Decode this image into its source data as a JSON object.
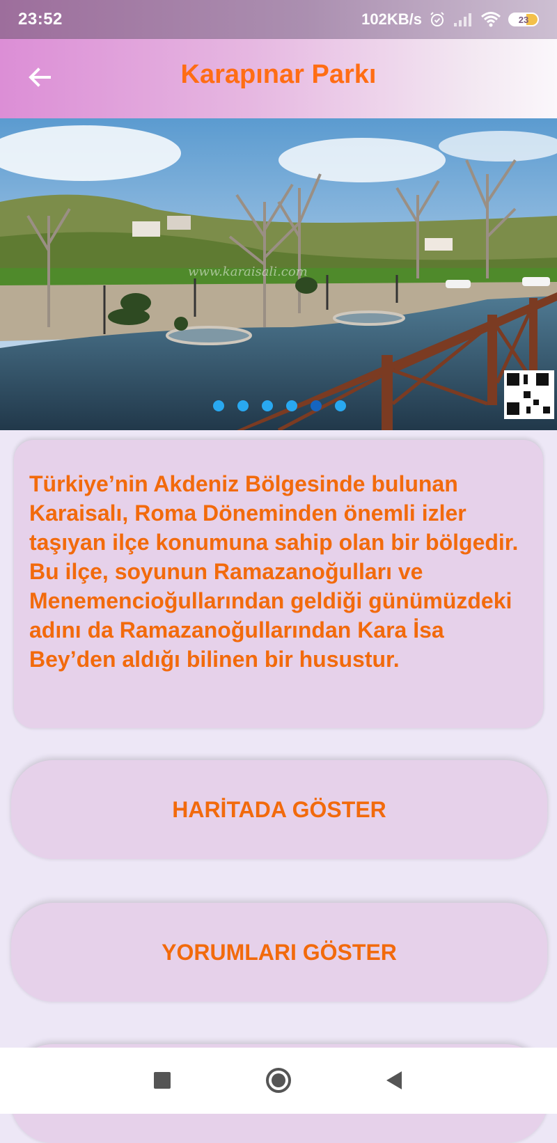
{
  "status_bar": {
    "time": "23:52",
    "speed": "102KB/s",
    "battery": "23"
  },
  "app_bar": {
    "title": "Karapınar Parkı",
    "back_icon": "arrow-back-icon"
  },
  "carousel": {
    "watermark": "www.karaisali.com",
    "page_count": 6,
    "active_index": 4
  },
  "description": "Türkiye’nin Akdeniz Bölgesinde bulunan Karaisalı, Roma Döneminden önemli izler taşıyan ilçe konumuna sahip olan bir bölgedir. Bu ilçe, soyunun Ramazanoğulları ve Menemencioğullarından geldiği günümüzdeki adını da Ramazanoğullarından Kara İsa Bey’den aldığı bilinen bir husustur.",
  "buttons": {
    "map": "HARİTADA GÖSTER",
    "comments": "YORUMLARI GÖSTER"
  },
  "colors": {
    "accent": "#ff6d14",
    "card": "#e6d1ea",
    "background": "#ede7f6"
  }
}
